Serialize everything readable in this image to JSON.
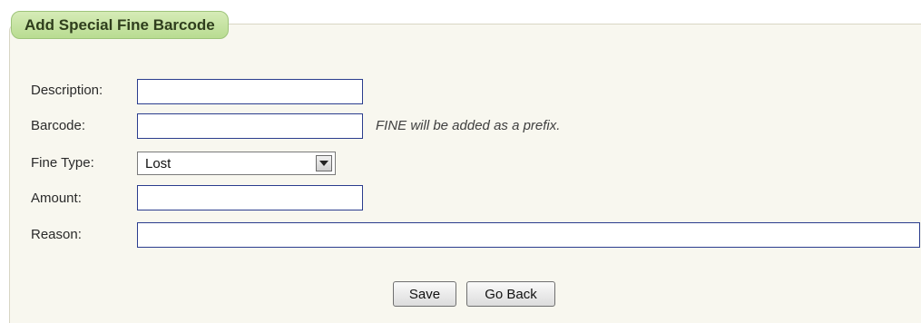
{
  "form": {
    "title": "Add Special Fine Barcode",
    "fields": {
      "description": {
        "label": "Description:",
        "value": ""
      },
      "barcode": {
        "label": "Barcode:",
        "value": "",
        "hint": "FINE will be added as a prefix."
      },
      "fine_type": {
        "label": "Fine Type:",
        "selected": "Lost"
      },
      "amount": {
        "label": "Amount:",
        "value": ""
      },
      "reason": {
        "label": "Reason:",
        "value": ""
      }
    },
    "buttons": {
      "save": "Save",
      "go_back": "Go Back"
    }
  },
  "colors": {
    "panel_bg": "#f8f7ef",
    "legend_bg": "#c6e3a2",
    "legend_text": "#2f3e1d",
    "input_border": "#2b3d8e"
  },
  "icons": {
    "dropdown": "chevron-down-icon"
  }
}
